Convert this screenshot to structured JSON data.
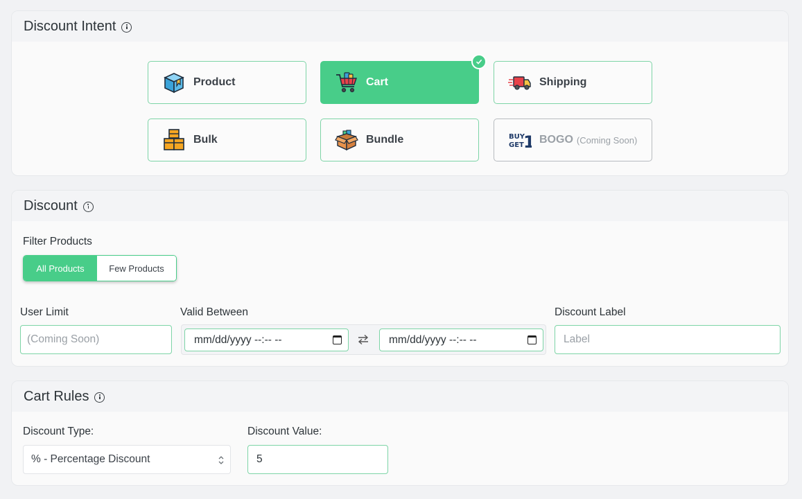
{
  "intent": {
    "title": "Discount Intent",
    "options": [
      {
        "label": "Product",
        "icon": "product-box-icon"
      },
      {
        "label": "Cart",
        "icon": "shopping-cart-icon",
        "selected": true
      },
      {
        "label": "Shipping",
        "icon": "delivery-truck-icon"
      },
      {
        "label": "Bulk",
        "icon": "stacked-boxes-icon"
      },
      {
        "label": "Bundle",
        "icon": "open-box-icon"
      },
      {
        "label": "BOGO",
        "icon": "buy-get-one-icon",
        "note": "(Coming Soon)",
        "disabled": true
      }
    ]
  },
  "discount": {
    "title": "Discount",
    "filter_label": "Filter Products",
    "filter_options": [
      "All Products",
      "Few Products"
    ],
    "filter_selected": "All Products",
    "user_limit_label": "User Limit",
    "user_limit_placeholder": "(Coming Soon)",
    "valid_between_label": "Valid Between",
    "date_start_placeholder": "mm/dd/yyyy --:-- --",
    "date_end_placeholder": "mm/dd/yyyy --:-- --",
    "discount_label_label": "Discount Label",
    "discount_label_placeholder": "Label"
  },
  "cart_rules": {
    "title": "Cart Rules",
    "discount_type_label": "Discount Type:",
    "discount_type_value": "% - Percentage Discount",
    "discount_value_label": "Discount Value:",
    "discount_value": "5"
  },
  "colors": {
    "accent": "#48cd89",
    "border_accent": "#7dd4a6",
    "card_bg": "#fafafa",
    "header_bg": "#f3f4f6",
    "page_bg": "#f1f2f4"
  }
}
